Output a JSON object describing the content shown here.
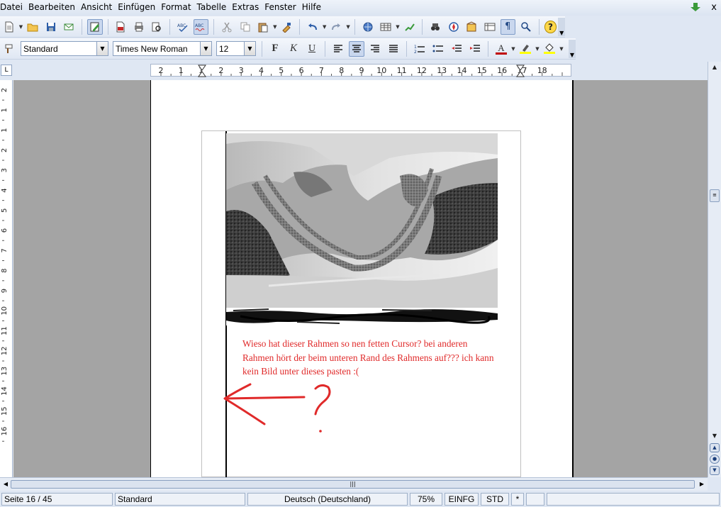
{
  "menubar": {
    "items": [
      "Datei",
      "Bearbeiten",
      "Ansicht",
      "Einfügen",
      "Format",
      "Tabelle",
      "Extras",
      "Fenster",
      "Hilfe"
    ],
    "close_glyph": "x"
  },
  "toolbar_standard": {
    "icons": [
      "new-document-icon",
      "open-folder-icon",
      "save-icon",
      "email-icon",
      "edit-mode-icon",
      "export-pdf-icon",
      "print-icon",
      "page-preview-icon",
      "spellcheck-icon",
      "autospellcheck-icon",
      "cut-icon",
      "copy-icon",
      "paste-icon",
      "clone-format-icon",
      "undo-icon",
      "redo-icon",
      "hyperlink-icon",
      "table-icon",
      "show-draw-functions-icon",
      "find-replace-icon",
      "navigator-icon",
      "gallery-icon",
      "data-sources-icon",
      "formatting-marks-icon",
      "zoom-icon",
      "help-icon"
    ],
    "formatting_marks_glyph": "¶",
    "help_glyph": "?"
  },
  "toolbar_formatting": {
    "paragraph_style": "Standard",
    "font_name": "Times New Roman",
    "font_size": "12",
    "bold_glyph": "F",
    "italic_glyph": "K",
    "underline_glyph": "U",
    "font_color_glyph": "A",
    "font_color": "#c00000",
    "highlight_color": "#ffff00",
    "background_color": "#ffff00"
  },
  "ruler": {
    "h_labels": [
      "2",
      "1",
      "1",
      "2",
      "3",
      "4",
      "5",
      "6",
      "7",
      "8",
      "9",
      "10",
      "11",
      "12",
      "13",
      "14",
      "15",
      "16",
      "17",
      "18"
    ],
    "v_labels": [
      "2",
      "1",
      "1",
      "2",
      "3",
      "4",
      "5",
      "6",
      "7",
      "8",
      "9",
      "10",
      "11",
      "12",
      "13",
      "14",
      "15",
      "16"
    ],
    "corner_glyph": "L"
  },
  "document": {
    "note_text": "Wieso hat dieser Rahmen so nen fetten Cursor? bei anderen Rahmen hört der beim unteren Rand des Rahmens auf??? ich kann kein Bild unter dieses pasten :(",
    "annotation_color": "#e02a2a",
    "annotation_question_mark": "?"
  },
  "statusbar": {
    "page": "Seite 16 / 45",
    "page_style": "Standard",
    "language": "Deutsch (Deutschland)",
    "zoom": "75%",
    "insert_mode": "EINFG",
    "selection_mode": "STD",
    "modified": "*"
  }
}
